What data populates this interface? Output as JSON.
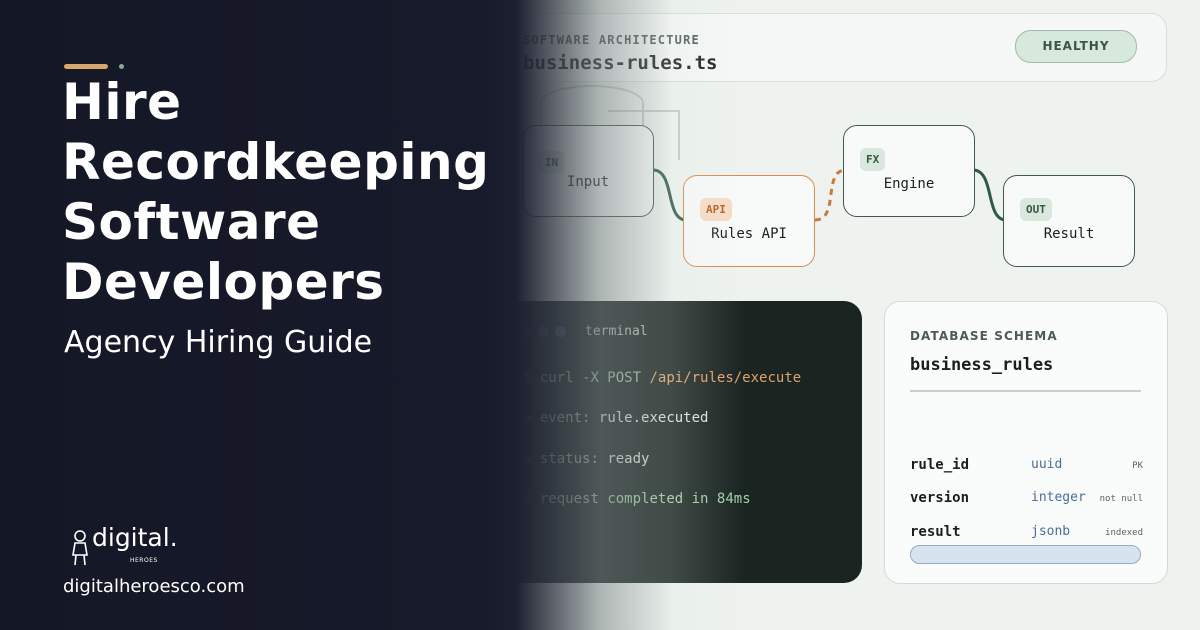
{
  "header": {
    "eyebrow": "SOFTWARE ARCHITECTURE",
    "filename": "business-rules.ts",
    "status_badge": "HEALTHY"
  },
  "flow": {
    "nodes": [
      {
        "tag": "IN",
        "label": "Input"
      },
      {
        "tag": "API",
        "label": "Rules API"
      },
      {
        "tag": "FX",
        "label": "Engine"
      },
      {
        "tag": "OUT",
        "label": "Result"
      }
    ]
  },
  "terminal": {
    "title": "terminal",
    "lines": [
      {
        "prefix": "$",
        "cmd": "curl -X POST",
        "arg": "/api/rules/execute"
      },
      {
        "prefix": "→",
        "key": "event:",
        "val": "rule.executed"
      },
      {
        "prefix": "→",
        "key": "status:",
        "val": "ready"
      },
      {
        "prefix": "✓",
        "key": "request",
        "val": "completed in 84ms"
      }
    ]
  },
  "schema": {
    "eyebrow": "DATABASE SCHEMA",
    "name": "business_rules",
    "rows": [
      {
        "field": "rule_id",
        "type": "uuid",
        "note": "PK"
      },
      {
        "field": "version",
        "type": "integer",
        "note": "not null"
      },
      {
        "field": "result",
        "type": "jsonb",
        "note": "indexed"
      }
    ]
  },
  "hero": {
    "title_lines": [
      "Hire",
      "Recordkeeping",
      "Software",
      "Developers"
    ],
    "subtitle": "Agency Hiring Guide"
  },
  "brand": {
    "logo_text": "digital.",
    "logo_sub": "HEROES",
    "website": "digitalheroesco.com"
  },
  "colors": {
    "dark_bg": "#141726",
    "accent": "#d6a66a",
    "node_border": "#3f5a4c",
    "api_border": "#d98a4c"
  }
}
